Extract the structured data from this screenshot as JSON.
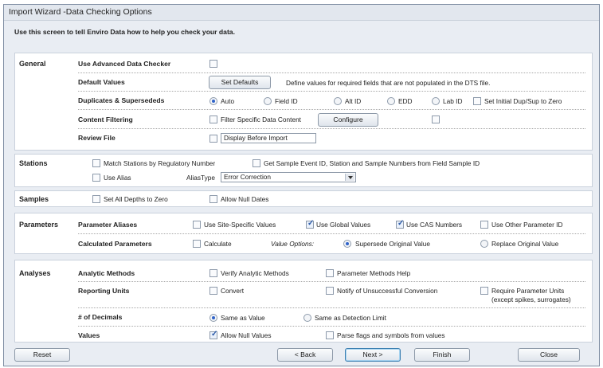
{
  "window": {
    "title": "Import Wizard -Data Checking Options"
  },
  "instructions": "Use this screen to tell Enviro Data how to help you check your data.",
  "general": {
    "label": "General",
    "advanced": {
      "label": "Use Advanced Data Checker",
      "checked": false
    },
    "default_values": {
      "label": "Default Values",
      "button": "Set Defaults",
      "description": "Define values for required fields that are not populated in the DTS file."
    },
    "duplicates": {
      "label": "Duplicates & Supersededs",
      "options": [
        "Auto",
        "Field ID",
        "Alt ID",
        "EDD",
        "Lab ID"
      ],
      "selected": "Auto",
      "initial_zero": {
        "label": "Set Initial Dup/Sup to Zero",
        "checked": false
      }
    },
    "content_filtering": {
      "label": "Content Filtering",
      "filter_label": "Filter Specific Data Content",
      "filter_checked": false,
      "configure_button": "Configure",
      "extra_checked": false
    },
    "review_file": {
      "label": "Review File",
      "checked": false,
      "value": "Display Before Import"
    }
  },
  "stations": {
    "label": "Stations",
    "match_regulatory": {
      "label": "Match Stations by Regulatory Number",
      "checked": false
    },
    "get_sample_event": {
      "label": "Get Sample Event ID, Station and Sample Numbers from Field Sample ID",
      "checked": false
    },
    "use_alias": {
      "label": "Use Alias",
      "checked": false
    },
    "alias_type": {
      "label": "AliasType",
      "value": "Error Correction"
    }
  },
  "samples": {
    "label": "Samples",
    "all_depths_zero": {
      "label": "Set All Depths to Zero",
      "checked": false
    },
    "allow_null_dates": {
      "label": "Allow Null Dates",
      "checked": false
    }
  },
  "parameters": {
    "label": "Parameters",
    "aliases": {
      "label": "Parameter Aliases",
      "site_specific": {
        "label": "Use Site-Specific Values",
        "checked": false
      },
      "global": {
        "label": "Use Global Values",
        "checked": true
      },
      "cas": {
        "label": "Use CAS Numbers",
        "checked": true
      },
      "other_id": {
        "label": "Use Other Parameter ID",
        "checked": false
      }
    },
    "calculated": {
      "label": "Calculated Parameters",
      "calculate": {
        "label": "Calculate",
        "checked": false
      },
      "value_options_label": "Value Options:",
      "options": [
        "Supersede Original Value",
        "Replace Original Value"
      ],
      "selected": "Supersede Original Value"
    }
  },
  "analyses": {
    "label": "Analyses",
    "analytic_methods": {
      "label": "Analytic Methods",
      "verify": {
        "label": "Verify Analytic Methods",
        "checked": false
      },
      "help": {
        "label": "Parameter Methods Help",
        "checked": false
      }
    },
    "reporting_units": {
      "label": "Reporting Units",
      "convert": {
        "label": "Convert",
        "checked": false
      },
      "notify": {
        "label": "Notify of Unsuccessful Conversion",
        "checked": false
      },
      "require": {
        "label": "Require Parameter Units",
        "sub": "(except spikes, surrogates)",
        "checked": false
      }
    },
    "decimals": {
      "label": "# of Decimals",
      "options": [
        "Same as Value",
        "Same as Detection Limit"
      ],
      "selected": "Same as Value"
    },
    "values": {
      "label": "Values",
      "allow_null": {
        "label": "Allow Null Values",
        "checked": true
      },
      "parse_flags": {
        "label": "Parse flags and symbols from values",
        "checked": false
      }
    }
  },
  "footer": {
    "reset": "Reset",
    "back": "< Back",
    "next": "Next >",
    "finish": "Finish",
    "close": "Close"
  }
}
